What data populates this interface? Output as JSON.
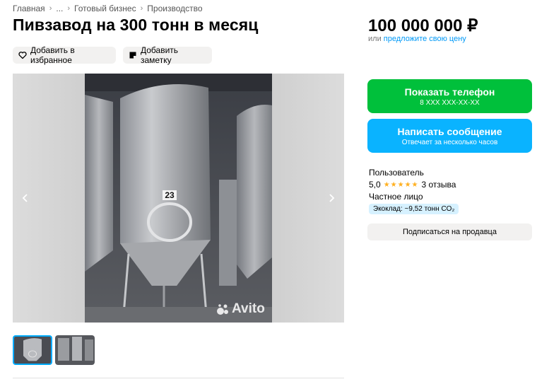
{
  "breadcrumb": {
    "items": [
      "Главная",
      "...",
      "Готовый бизнес",
      "Производство"
    ]
  },
  "title": "Пивзавод на 300 тонн в месяц",
  "actions": {
    "favorite_label": "Добавить в избранное",
    "note_label": "Добавить заметку"
  },
  "gallery": {
    "tank_number": "23",
    "watermark": "Avito",
    "thumbnails_count": 2,
    "active_thumbnail": 1
  },
  "price": {
    "value": "100 000 000 ₽",
    "or_text": "или",
    "offer_link": "предложите свою цену"
  },
  "contact": {
    "phone_label": "Показать телефон",
    "phone_masked": "8 XXX XXX-XX-XX",
    "message_label": "Написать сообщение",
    "message_sub": "Отвечает за несколько часов"
  },
  "seller": {
    "name": "Пользователь",
    "rating": "5,0",
    "stars": "★★★★★",
    "reviews": "3 отзыва",
    "type": "Частное лицо",
    "eco": "Экоклад: ~9,52 тонн CO₂",
    "subscribe_label": "Подписаться на продавца"
  },
  "colors": {
    "phone_button": "#00c03b",
    "message_button": "#0ab3ff",
    "link": "#0099f7",
    "star": "#ffb021"
  }
}
